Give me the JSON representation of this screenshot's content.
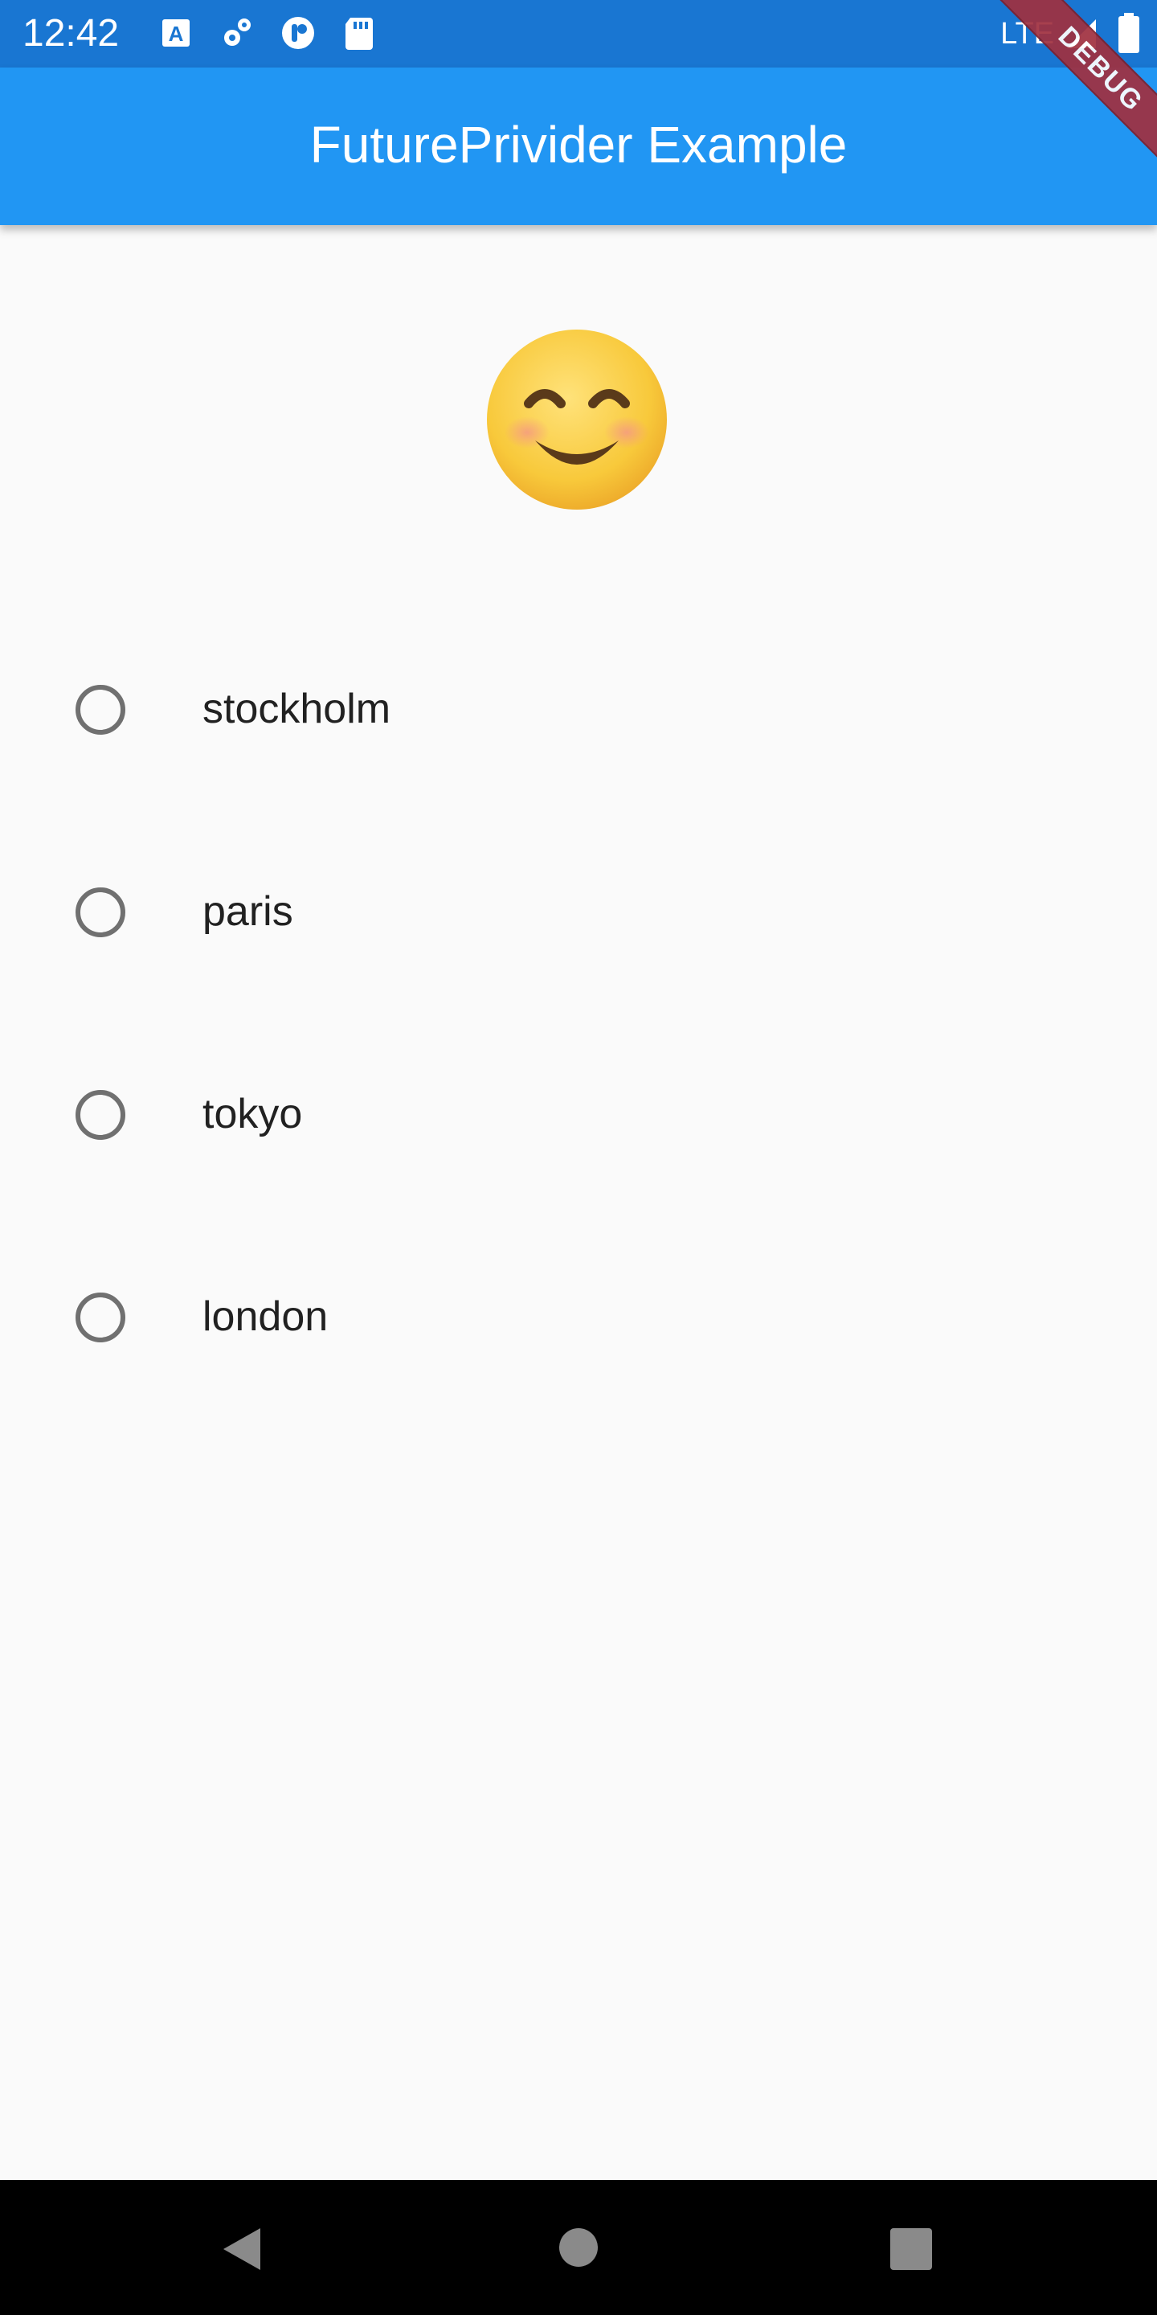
{
  "status_bar": {
    "time": "12:42",
    "network": "LTE",
    "icons": [
      "font-app-icon",
      "settings-gear-icon",
      "rounded-app-icon",
      "sd-card-icon",
      "signal-icon",
      "battery-icon"
    ]
  },
  "app_bar": {
    "title": "FuturePrivider Example",
    "background": "#2196f3"
  },
  "debug_banner": {
    "label": "DEBUG"
  },
  "emoji": {
    "icon": "smiling-face-emoji"
  },
  "radio_options": [
    {
      "label": "stockholm",
      "selected": false
    },
    {
      "label": "paris",
      "selected": false
    },
    {
      "label": "tokyo",
      "selected": false
    },
    {
      "label": "london",
      "selected": false
    }
  ],
  "nav_bar": {
    "buttons": [
      "back-icon",
      "home-icon",
      "recents-icon"
    ]
  }
}
